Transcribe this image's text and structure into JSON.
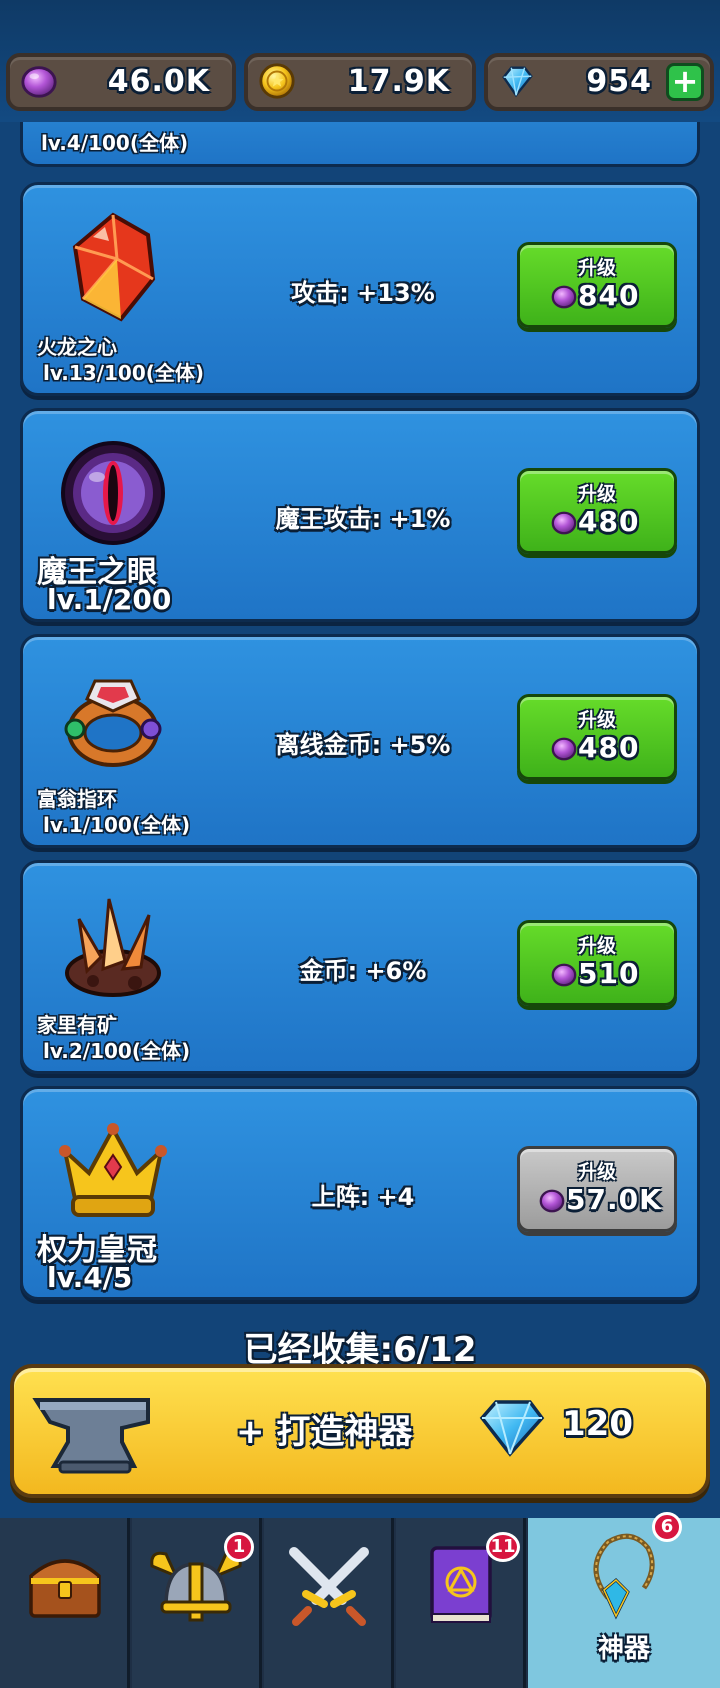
{
  "resources": [
    {
      "icon": "purple-orb-icon",
      "value": "46.0K"
    },
    {
      "icon": "gold-coin-icon",
      "value": "17.9K"
    },
    {
      "icon": "diamond-icon",
      "value": "954"
    }
  ],
  "partial_item": {
    "level": "lv.4/100(全体)"
  },
  "items": [
    {
      "name": "火龙之心",
      "level": "lv.13/100(全体)",
      "effect": "攻击: +13%",
      "upgrade_label": "升级",
      "cost": "840",
      "icon": "fire-gem-icon",
      "state": "available"
    },
    {
      "name": "魔王之眼",
      "level": "lv.1/200",
      "effect": "魔王攻击: +1%",
      "upgrade_label": "升级",
      "cost": "480",
      "icon": "demon-eye-icon",
      "state": "available"
    },
    {
      "name": "富翁指环",
      "level": "lv.1/100(全体)",
      "effect": "离线金币: +5%",
      "upgrade_label": "升级",
      "cost": "480",
      "icon": "gem-ring-icon",
      "state": "available"
    },
    {
      "name": "家里有矿",
      "level": "lv.2/100(全体)",
      "effect": "金币: +6%",
      "upgrade_label": "升级",
      "cost": "510",
      "icon": "crystal-ore-icon",
      "state": "available"
    },
    {
      "name": "权力皇冠",
      "level": "lv.4/5",
      "effect": "上阵: +4",
      "upgrade_label": "升级",
      "cost": "57.0K",
      "icon": "crown-icon",
      "state": "disabled"
    }
  ],
  "collected": "已经收集:6/12",
  "forge": {
    "label": "+ 打造神器",
    "cost": "120"
  },
  "nav": [
    {
      "icon": "treasure-chest-icon",
      "badge": "",
      "label": ""
    },
    {
      "icon": "viking-helmet-icon",
      "badge": "1",
      "label": ""
    },
    {
      "icon": "crossed-swords-icon",
      "badge": "",
      "label": ""
    },
    {
      "icon": "spell-book-icon",
      "badge": "11",
      "label": ""
    },
    {
      "icon": "amulet-icon",
      "badge": "6",
      "label": "神器"
    }
  ],
  "colors": {
    "upgrade_green": "#4fc41f",
    "upgrade_disabled": "#b0b0b0",
    "forge_yellow": "#f7c82a",
    "active_tab": "#7fc7df",
    "badge_red": "#d7163f"
  }
}
